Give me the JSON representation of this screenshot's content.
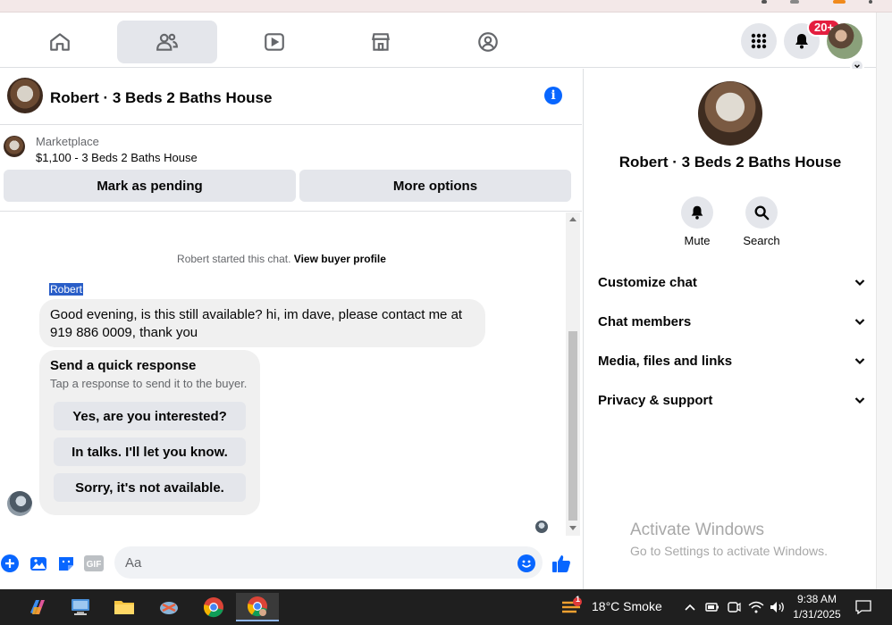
{
  "navbar": {
    "tabs": [
      {
        "name": "home",
        "active": false
      },
      {
        "name": "friends",
        "active": true
      },
      {
        "name": "watch",
        "active": false
      },
      {
        "name": "marketplace",
        "active": false
      },
      {
        "name": "groups",
        "active": false
      }
    ],
    "notifications_badge": "20+"
  },
  "chat": {
    "title": "Robert · 3 Beds 2 Baths House",
    "listing": {
      "source": "Marketplace",
      "price_title": "$1,100 - 3 Beds 2 Baths House"
    },
    "buttons": {
      "mark_pending": "Mark as pending",
      "more_options": "More options"
    },
    "started_text": "Robert started this chat.",
    "view_profile": "View buyer profile",
    "sender": "Robert",
    "message": "Good evening, is this still available?  hi, im dave, please contact me at 919 886 0009, thank you",
    "quick_response": {
      "title": "Send a quick response",
      "subtitle": "Tap a response to send it to the buyer.",
      "options": [
        "Yes, are you interested?",
        "In talks. I'll let you know.",
        "Sorry, it's not available."
      ]
    },
    "composer": {
      "placeholder": "Aa",
      "gif_label": "GIF"
    }
  },
  "right_panel": {
    "title": "Robert · 3 Beds 2 Baths House",
    "actions": [
      {
        "label": "Mute",
        "icon": "bell-icon"
      },
      {
        "label": "Search",
        "icon": "search-icon"
      }
    ],
    "sections": [
      "Customize chat",
      "Chat members",
      "Media, files and links",
      "Privacy & support"
    ]
  },
  "watermark": {
    "line1": "Activate Windows",
    "line2": "Go to Settings to activate Windows."
  },
  "taskbar": {
    "weather": "18°C  Smoke",
    "weather_badge": "1",
    "time": "9:38 AM",
    "date": "1/31/2025"
  },
  "colors": {
    "accent": "#0866ff",
    "badge": "#e41e3f",
    "bubble": "#f0f0f0",
    "button": "#e4e6eb"
  }
}
